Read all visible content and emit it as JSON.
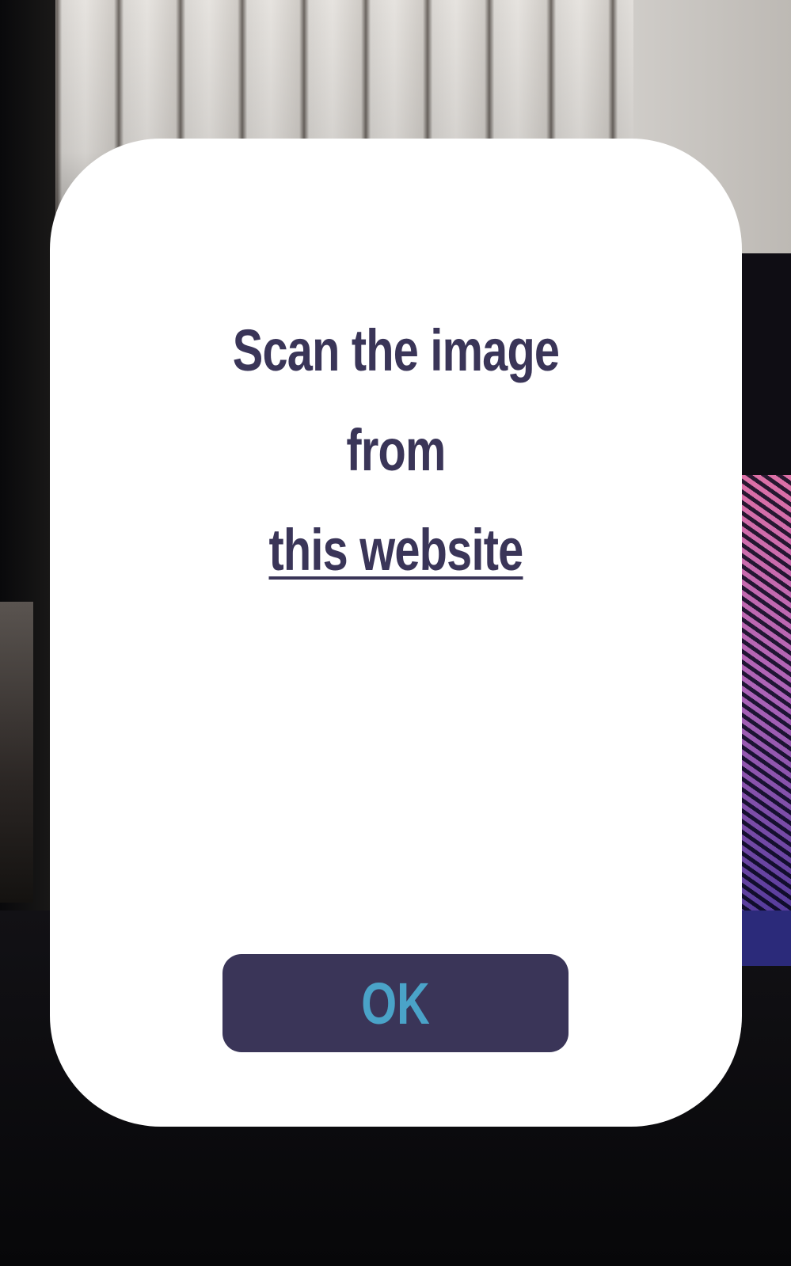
{
  "dialog": {
    "title_line_1": "Scan the image",
    "title_line_2": "from",
    "link_text": "this website",
    "ok_label": "OK"
  },
  "colors": {
    "text": "#3a3558",
    "button_bg": "#3a3558",
    "button_text": "#4aa3c8",
    "card_bg": "#ffffff"
  }
}
